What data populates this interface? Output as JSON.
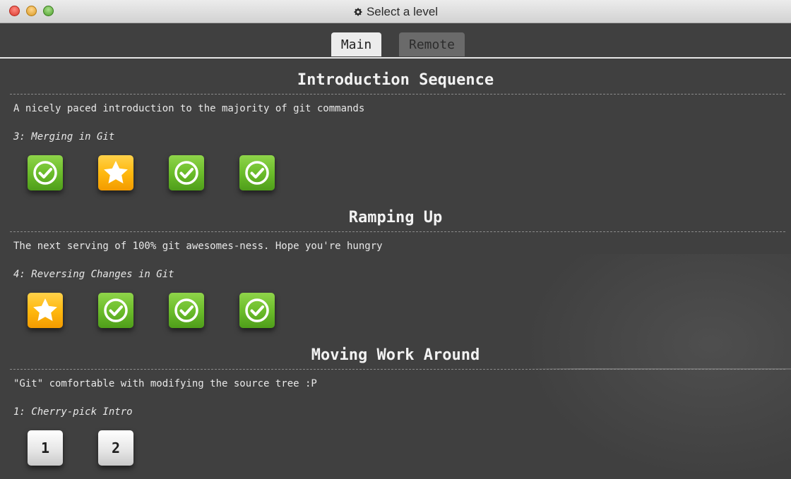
{
  "window": {
    "title": "Select a level",
    "title_icon": "gear-icon",
    "controls": [
      "close-icon",
      "minimize-icon",
      "maximize-icon"
    ]
  },
  "tabs": [
    {
      "label": "Main",
      "selected": true
    },
    {
      "label": "Remote",
      "selected": false
    }
  ],
  "sections": [
    {
      "title": "Introduction Sequence",
      "about": "A nicely paced introduction to the majority of git commands",
      "current": "3: Merging in Git",
      "levels": [
        {
          "state": "done",
          "icon": "checkmark-icon"
        },
        {
          "state": "starred",
          "icon": "star-icon"
        },
        {
          "state": "done",
          "icon": "checkmark-icon"
        },
        {
          "state": "done",
          "icon": "checkmark-icon"
        }
      ]
    },
    {
      "title": "Ramping Up",
      "about": "The next serving of 100% git awesomes-ness. Hope you're hungry",
      "current": "4: Reversing Changes in Git",
      "levels": [
        {
          "state": "starred",
          "icon": "star-icon"
        },
        {
          "state": "done",
          "icon": "checkmark-icon"
        },
        {
          "state": "done",
          "icon": "checkmark-icon"
        },
        {
          "state": "done",
          "icon": "checkmark-icon"
        }
      ]
    },
    {
      "title": "Moving Work Around",
      "about": "\"Git\" comfortable with modifying the source tree :P",
      "current": "1: Cherry-pick Intro",
      "levels": [
        {
          "state": "numbered",
          "label": "1"
        },
        {
          "state": "numbered",
          "label": "2"
        }
      ]
    }
  ],
  "colors": {
    "background": "#404040",
    "done": "#6cbd2b",
    "starred": "#ffb90f",
    "numbered": "#e4e4e4"
  }
}
